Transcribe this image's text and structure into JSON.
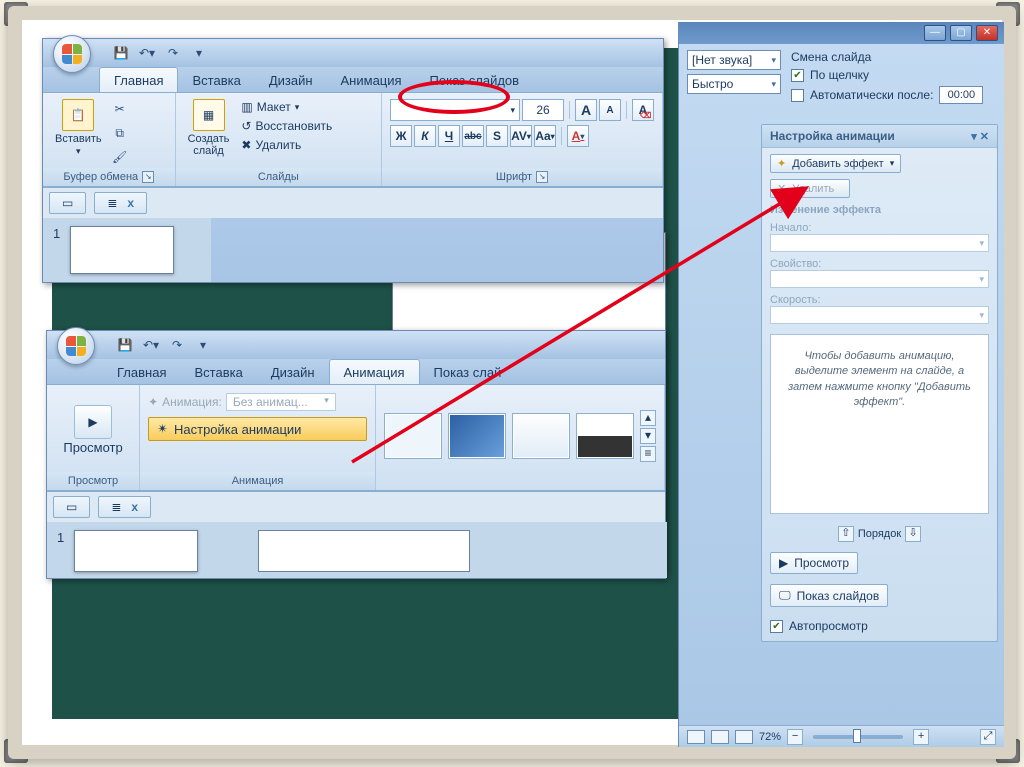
{
  "tabs": {
    "home": "Главная",
    "insert": "Вставка",
    "design": "Дизайн",
    "animation": "Анимация",
    "slideshow": "Показ слайдов"
  },
  "slideshow_tab2": "Показ слай",
  "ribbon1": {
    "paste": "Вставить",
    "clipboard": "Буфер обмена",
    "new_slide": "Создать\nслайд",
    "layout": "Макет",
    "reset": "Восстановить",
    "delete": "Удалить",
    "slides": "Слайды",
    "font_size": "26",
    "font_group": "Шрифт",
    "b": "Ж",
    "i": "К",
    "u": "Ч",
    "strike": "abc",
    "shadow": "S",
    "av": "AV",
    "aa": "Aa",
    "afill": "A"
  },
  "ribbon2": {
    "preview": "Просмотр",
    "preview_group": "Просмотр",
    "anim_label": "Анимация:",
    "anim_value": "Без анимац...",
    "config": "Настройка анимации",
    "anim_group": "Анимация"
  },
  "pane": {
    "x": "x"
  },
  "transition": {
    "sound": "[Нет звука]",
    "speed": "Быстро",
    "title": "Смена слайда",
    "on_click": "По щелчку",
    "auto_after": "Автоматически после:",
    "time": "00:00"
  },
  "anim_pane": {
    "title": "Настройка анимации",
    "add": "Добавить эффект",
    "remove": "Удалить",
    "change": "Изменение эффекта",
    "start": "Начало:",
    "property": "Свойство:",
    "speed": "Скорость:",
    "hint": "Чтобы добавить анимацию, выделите элемент на слайде, а затем нажмите кнопку \"Добавить эффект\".",
    "order": "Порядок",
    "play": "Просмотр",
    "slideshow": "Показ слайдов",
    "autoplay": "Автопросмотр"
  },
  "status": {
    "zoom": "72%"
  }
}
